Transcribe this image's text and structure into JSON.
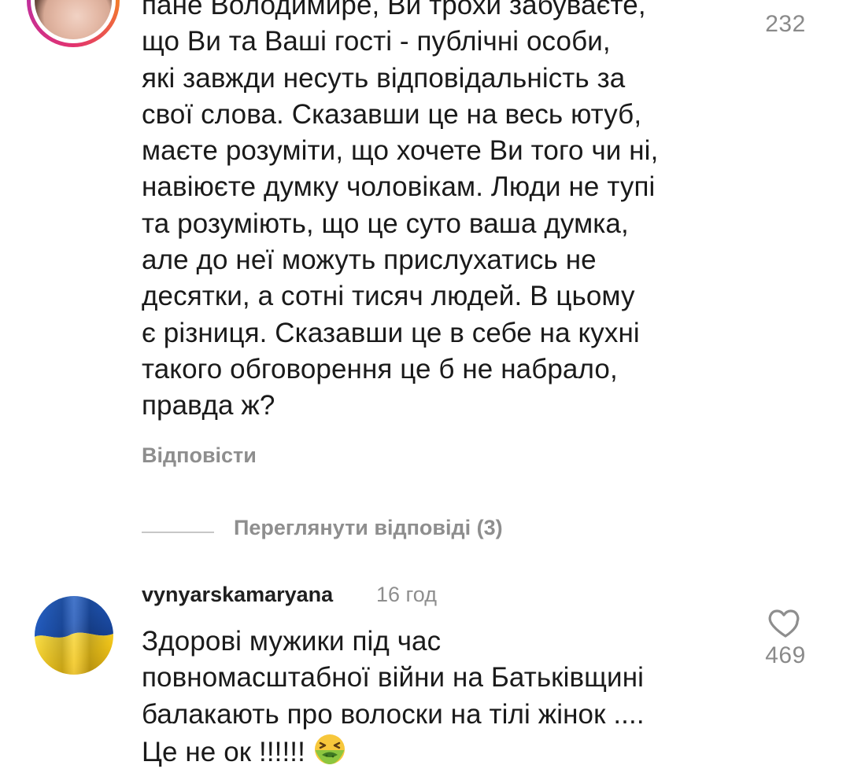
{
  "comments": [
    {
      "text": "пане Володимире, Ви трохи забуваєте,\nщо Ви та Ваші гості - публічні особи,\nякі завжди несуть відповідальність за\nсвої слова. Сказавши це на весь ютуб,\nмаєте розуміти, що хочете Ви того чи ні,\nнавіюєте думку чоловікам. Люди не тупі\nта розуміють, що це суто ваша думка,\nале до неї можуть прислухатись не\nдесятки, а сотні тисяч людей. В цьому\nє різниця. Сказавши це в себе на кухні\nтакого обговорення це б не набрало,\nправда ж?",
      "likes": "232",
      "reply_label": "Відповісти",
      "view_replies_label": "Переглянути відповіді (3)",
      "avatar_icon": "profile-photo"
    },
    {
      "username": "vynyarskamaryana",
      "time": "16 год",
      "text": "Здорові мужики під час\nповномасштабної війни на Батьківщині\nбалакають про волоски на тілі жінок ....\nЦе не ок !!!!!!",
      "likes": "469",
      "emoji_icon": "nauseated-face-emoji",
      "avatar_icon": "ukraine-flag"
    }
  ],
  "colors": {
    "secondary_text": "#8e8e8e",
    "flag_blue": "#1f56b8",
    "flag_yellow": "#f6d21a",
    "emoji_green": "#8cc63f"
  }
}
